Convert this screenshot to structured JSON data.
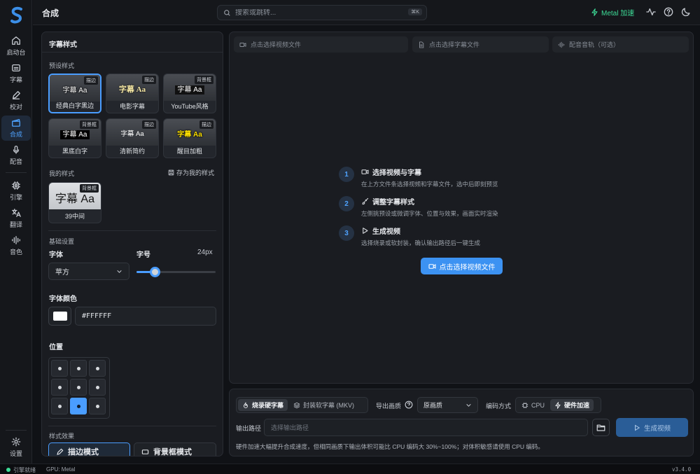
{
  "header": {
    "title": "合成",
    "search_placeholder": "搜索或跳转...",
    "search_shortcut": "⌘K",
    "metal_label": "Metal 加速"
  },
  "sidebar": {
    "items": [
      {
        "label": "启动台",
        "icon": "home-icon"
      },
      {
        "label": "字幕",
        "icon": "subtitle-icon"
      },
      {
        "label": "校对",
        "icon": "pen-icon"
      },
      {
        "label": "合成",
        "icon": "clapper-icon",
        "active": true
      },
      {
        "label": "配音",
        "icon": "mic-icon"
      },
      {
        "label": "引擎",
        "icon": "chip-icon"
      },
      {
        "label": "翻译",
        "icon": "translate-icon"
      },
      {
        "label": "音色",
        "icon": "waveform-icon"
      },
      {
        "label": "设置",
        "icon": "gear-icon"
      }
    ]
  },
  "style_panel": {
    "title": "字幕样式",
    "preset_label": "预设样式",
    "presets": [
      {
        "name": "经典白字黑边",
        "tag": "描边",
        "sample": "字幕 Aa",
        "color": "#ffffff"
      },
      {
        "name": "电影字幕",
        "tag": "描边",
        "sample": "字幕 Aa",
        "color": "#f7e9a6"
      },
      {
        "name": "YouTube风格",
        "tag": "背景框",
        "sample": "字幕 Aa",
        "color": "#ffffff"
      },
      {
        "name": "黑底白字",
        "tag": "背景框",
        "sample": "字幕 Aa",
        "color": "#ffffff"
      },
      {
        "name": "清新简约",
        "tag": "描边",
        "sample": "字幕 Aa",
        "color": "#ffffff"
      },
      {
        "name": "醒目加粗",
        "tag": "描边",
        "sample": "字幕 Aa",
        "color": "#ffe100"
      }
    ],
    "my_styles_label": "我的样式",
    "save_style_label": "存为我的样式",
    "my_styles": [
      {
        "name": "39中间",
        "tag": "背景框",
        "sample": "字幕 Aa"
      }
    ],
    "basic_label": "基础设置",
    "font_label": "字体",
    "font_value": "苹方",
    "size_label": "字号",
    "size_value": "24px",
    "size_fraction": 0.24,
    "color_label": "字体颜色",
    "color_value": "#FFFFFF",
    "position_label": "位置",
    "position_selected": "bottom-center",
    "effects_label": "样式效果",
    "effects": [
      "描边模式",
      "背景框模式"
    ]
  },
  "preview": {
    "pick_video": "点击选择视频文件",
    "pick_subtitle": "点击选择字幕文件",
    "pick_audio": "配音音轨（可选）",
    "steps": [
      {
        "num": "1",
        "title": "选择视频与字幕",
        "desc": "在上方文件条选择视频和字幕文件，选中后即刻预览"
      },
      {
        "num": "2",
        "title": "调整字幕样式",
        "desc": "左侧挑预设或微调字体、位置与效果，画面实时渲染"
      },
      {
        "num": "3",
        "title": "生成视频",
        "desc": "选择烧录或软封装，确认输出路径后一键生成"
      }
    ],
    "cta": "点击选择视频文件"
  },
  "output": {
    "mode_burn": "烧录硬字幕",
    "mode_soft": "封装软字幕 (MKV)",
    "quality_label": "导出画质",
    "quality_value": "原画质",
    "encode_label": "编码方式",
    "encode_cpu": "CPU",
    "encode_hw": "硬件加速",
    "path_label": "输出路径",
    "path_placeholder": "选择输出路径",
    "generate": "生成视频",
    "hint": "硬件加速大幅提升合成速度，但相同画质下输出体积可能比 CPU 编码大 30%~100%；对体积敏感请使用 CPU 编码。"
  },
  "status": {
    "engine": "引擎就绪",
    "gpu": "GPU: Metal",
    "version": "v3.4.0"
  },
  "colors": {
    "accent": "#4a9dff",
    "success": "#3ddc97",
    "background": "#101216",
    "panel": "#1a1c21"
  }
}
